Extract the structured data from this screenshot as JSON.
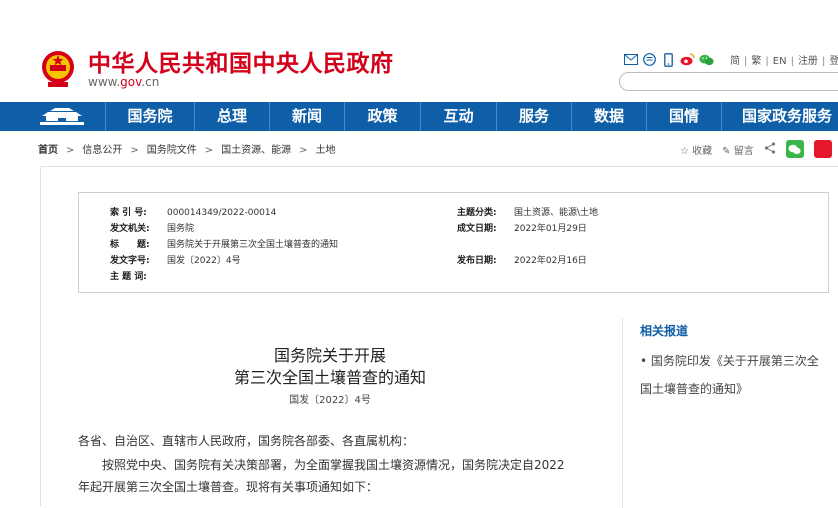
{
  "header": {
    "site_title": "中华人民共和国中央人民政府",
    "url_prefix": "www.",
    "url_domain": "gov",
    "url_suffix": ".cn",
    "lang_links": [
      "简",
      "繁",
      "EN",
      "注册",
      "登"
    ]
  },
  "nav": {
    "items": [
      "国务院",
      "总理",
      "新闻",
      "政策",
      "互动",
      "服务",
      "数据",
      "国情",
      "国家政务服务"
    ]
  },
  "breadcrumb": [
    "首页",
    "信息公开",
    "国务院文件",
    "国土资源、能源",
    "土地"
  ],
  "tools": {
    "favorite": "收藏",
    "comment": "留言"
  },
  "meta": {
    "index_label": "索 引 号:",
    "index_value": "000014349/2022-00014",
    "category_label": "主题分类:",
    "category_value": "国土资源、能源\\土地",
    "issuer_label": "发文机关:",
    "issuer_value": "国务院",
    "written_label": "成文日期:",
    "written_value": "2022年01月29日",
    "title_label": "标　　题:",
    "title_value": "国务院关于开展第三次全国土壤普查的通知",
    "docno_label": "发文字号:",
    "docno_value": "国发〔2022〕4号",
    "published_label": "发布日期:",
    "published_value": "2022年02月16日",
    "keywords_label": "主 题 词:",
    "keywords_value": ""
  },
  "article": {
    "title_line1": "国务院关于开展",
    "title_line2": "第三次全国土壤普查的通知",
    "doc_number": "国发〔2022〕4号",
    "salutation": "各省、自治区、直辖市人民政府，国务院各部委、各直属机构：",
    "body_line1": "按照党中央、国务院有关决策部署，为全面掌握我国土壤资源情况，国务院决定自2022",
    "body_line2": "年起开展第三次全国土壤普查。现将有关事项通知如下："
  },
  "related": {
    "heading": "相关报道",
    "items": [
      "国务院印发《关于开展第三次全国土壤普查的通知》"
    ]
  }
}
